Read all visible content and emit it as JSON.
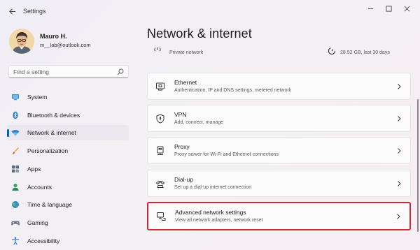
{
  "window": {
    "title": "Settings"
  },
  "user": {
    "name": "Mauro H.",
    "email": "m__lab@outlook.com"
  },
  "search": {
    "placeholder": "Find a setting"
  },
  "sidebar": {
    "items": [
      {
        "label": "System",
        "icon": "monitor-icon",
        "active": false
      },
      {
        "label": "Bluetooth & devices",
        "icon": "bluetooth-icon",
        "active": false
      },
      {
        "label": "Network & internet",
        "icon": "wifi-icon",
        "active": true
      },
      {
        "label": "Personalization",
        "icon": "brush-icon",
        "active": false
      },
      {
        "label": "Apps",
        "icon": "apps-icon",
        "active": false
      },
      {
        "label": "Accounts",
        "icon": "person-icon",
        "active": false
      },
      {
        "label": "Time & language",
        "icon": "globe-icon",
        "active": false
      },
      {
        "label": "Gaming",
        "icon": "gamepad-icon",
        "active": false
      },
      {
        "label": "Accessibility",
        "icon": "accessibility-icon",
        "active": false
      }
    ]
  },
  "main": {
    "title": "Network & internet",
    "top_partial": {
      "left_text": "Private network",
      "right_text": "28.52 GB, last 30 days"
    },
    "cards": [
      {
        "title": "Ethernet",
        "subtitle": "Authentication, IP and DNS settings, metered network",
        "icon": "ethernet-icon"
      },
      {
        "title": "VPN",
        "subtitle": "Add, connect, manage",
        "icon": "shield-icon"
      },
      {
        "title": "Proxy",
        "subtitle": "Proxy server for Wi-Fi and Ethernet connections",
        "icon": "proxy-server-icon"
      },
      {
        "title": "Dial-up",
        "subtitle": "Set up a dial-up internet connection",
        "icon": "phone-icon"
      },
      {
        "title": "Advanced network settings",
        "subtitle": "View all network adapters, network reset",
        "icon": "network-pc-icon",
        "highlighted": true
      }
    ]
  },
  "colors": {
    "accent": "#0067c0",
    "highlight": "#d0273a"
  }
}
